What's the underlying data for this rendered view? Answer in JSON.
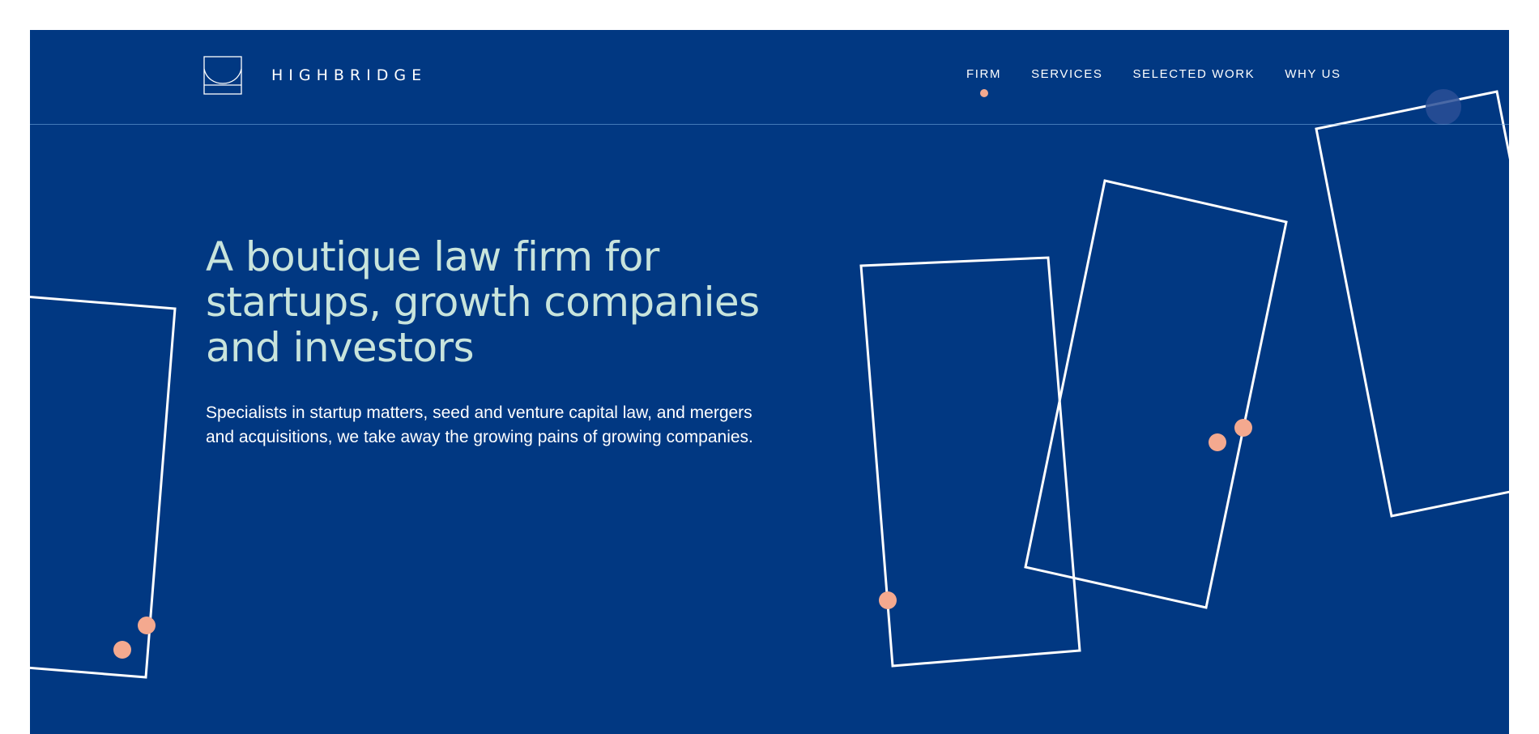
{
  "brand": {
    "name": "HIGHBRIDGE",
    "logo_icon": "bridge-logo-icon"
  },
  "nav": {
    "items": [
      {
        "label": "FIRM",
        "active": true
      },
      {
        "label": "SERVICES",
        "active": false
      },
      {
        "label": "SELECTED WORK",
        "active": false
      },
      {
        "label": "WHY US",
        "active": false
      }
    ]
  },
  "hero": {
    "title": "A boutique law firm for startups, growth companies and investors",
    "subtitle": "Specialists in startup matters, seed and venture capital law, and mergers and acquisitions, we take away the growing pains of growing companies."
  },
  "colors": {
    "background": "#013882",
    "accent": "#f4a98f",
    "heading": "#c8e4dc",
    "outline": "#ffffff"
  }
}
